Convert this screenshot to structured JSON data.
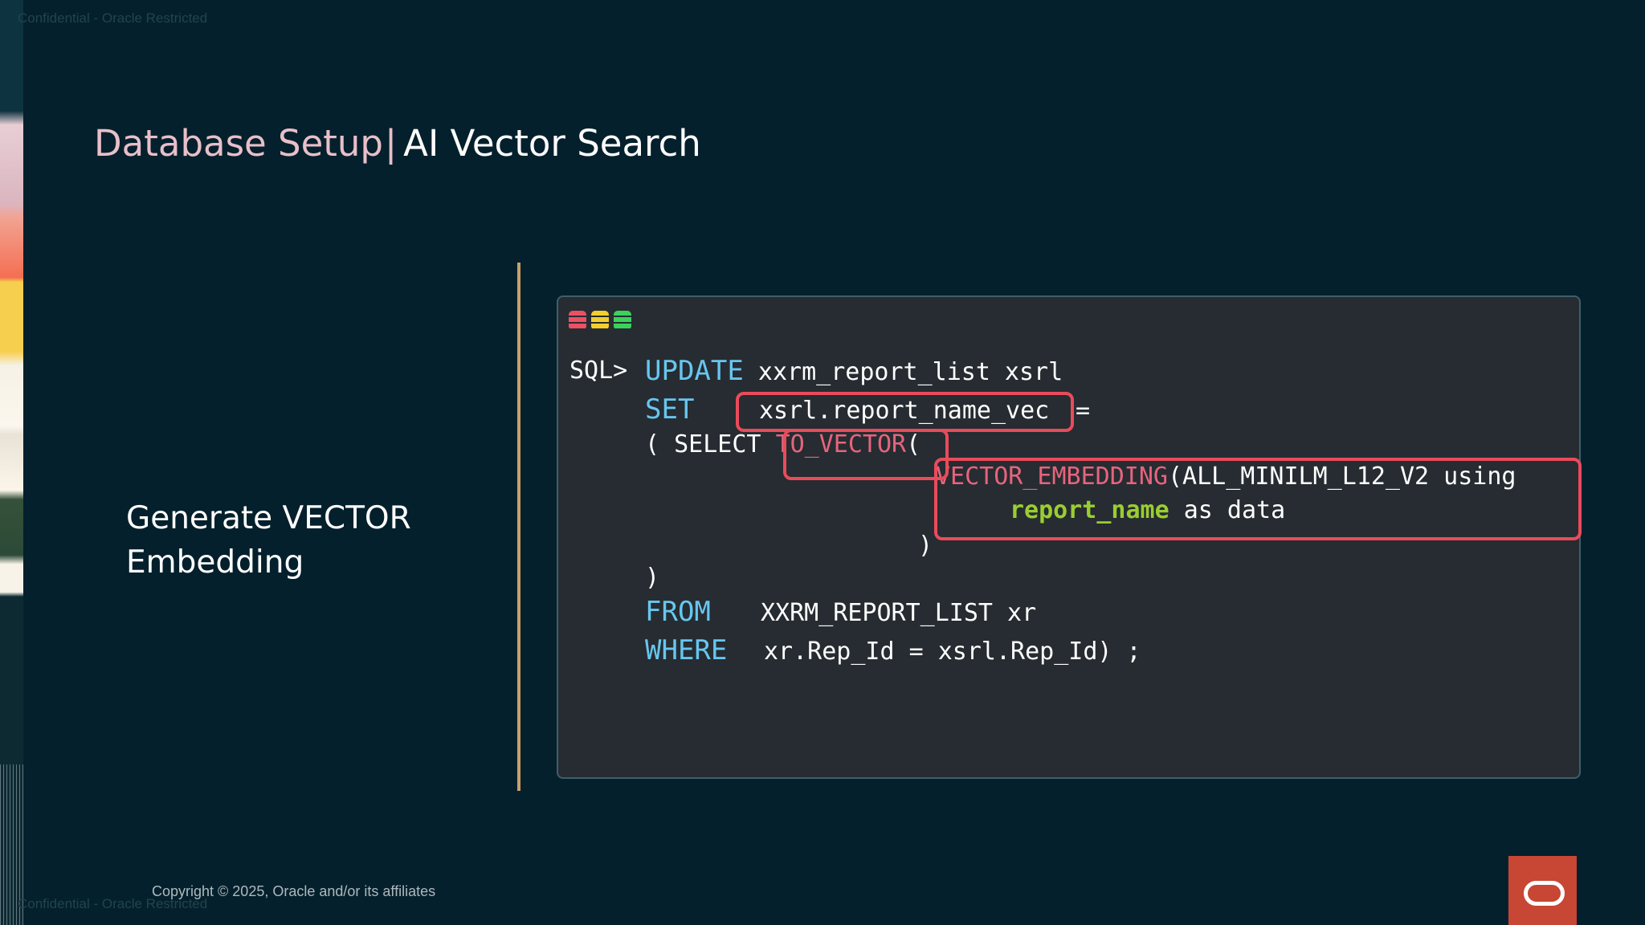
{
  "classification": {
    "label": "Confidential - Oracle Restricted"
  },
  "slide": {
    "title_part1": "Database Setup",
    "title_separator": "|",
    "title_part2": "AI Vector Search",
    "left_text": "Generate VECTOR Embedding",
    "copyright": "Copyright © 2025, Oracle and/or its affiliates"
  },
  "terminal": {
    "icons": [
      "database-icon-red",
      "database-icon-yellow",
      "database-icon-green"
    ],
    "prompt": "SQL>",
    "lines": {
      "l1_kw": "UPDATE",
      "l1_rest": " xxrm_report_list xsrl",
      "l2_kw": "SET",
      "l2_target": "xsrl.report_name_vec",
      "l2_eq": "=",
      "l3_open": "( SELECT ",
      "l3_fn": "TO_VECTOR",
      "l3_paren": "(",
      "l4_fn": "VECTOR_EMBEDDING",
      "l4_rest": "(ALL_MINILM_L12_V2 using",
      "l5_col": "report_name",
      "l5_rest": " as data",
      "l6_close": ")",
      "l7_close": ")",
      "l8_kw": "FROM",
      "l8_rest": "XXRM_REPORT_LIST xr",
      "l9_kw": "WHERE",
      "l9_rest": "xr.Rep_Id = xsrl.Rep_Id) ;"
    }
  },
  "colors": {
    "background": "#04202c",
    "keyword": "#67c6ef",
    "function": "#e6647d",
    "column": "#9acd32",
    "highlight_box": "#e94b5b",
    "divider": "#c7a16a",
    "terminal_bg": "#262c31",
    "oracle_red": "#c74634"
  },
  "logo": {
    "name": "oracle-logo"
  }
}
